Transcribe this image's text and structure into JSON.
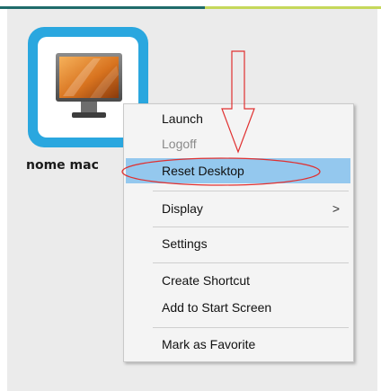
{
  "desktop": {
    "icon": {
      "name": "monitor-icon",
      "label": "nome mac"
    }
  },
  "context_menu": {
    "items": [
      {
        "label": "Launch",
        "enabled": true
      },
      {
        "label": "Logoff",
        "enabled": false
      },
      {
        "label": "Reset Desktop",
        "enabled": true,
        "highlighted": true
      },
      {
        "label": "Display",
        "enabled": true,
        "submenu_arrow": ">"
      },
      {
        "label": "Settings",
        "enabled": true
      },
      {
        "label": "Create Shortcut",
        "enabled": true
      },
      {
        "label": "Add to Start Screen",
        "enabled": true
      },
      {
        "label": "Mark as Favorite",
        "enabled": true
      }
    ]
  },
  "colors": {
    "icon_frame": "#2aa7df",
    "highlight": "#94c8ee",
    "annotation": "#e03030"
  }
}
